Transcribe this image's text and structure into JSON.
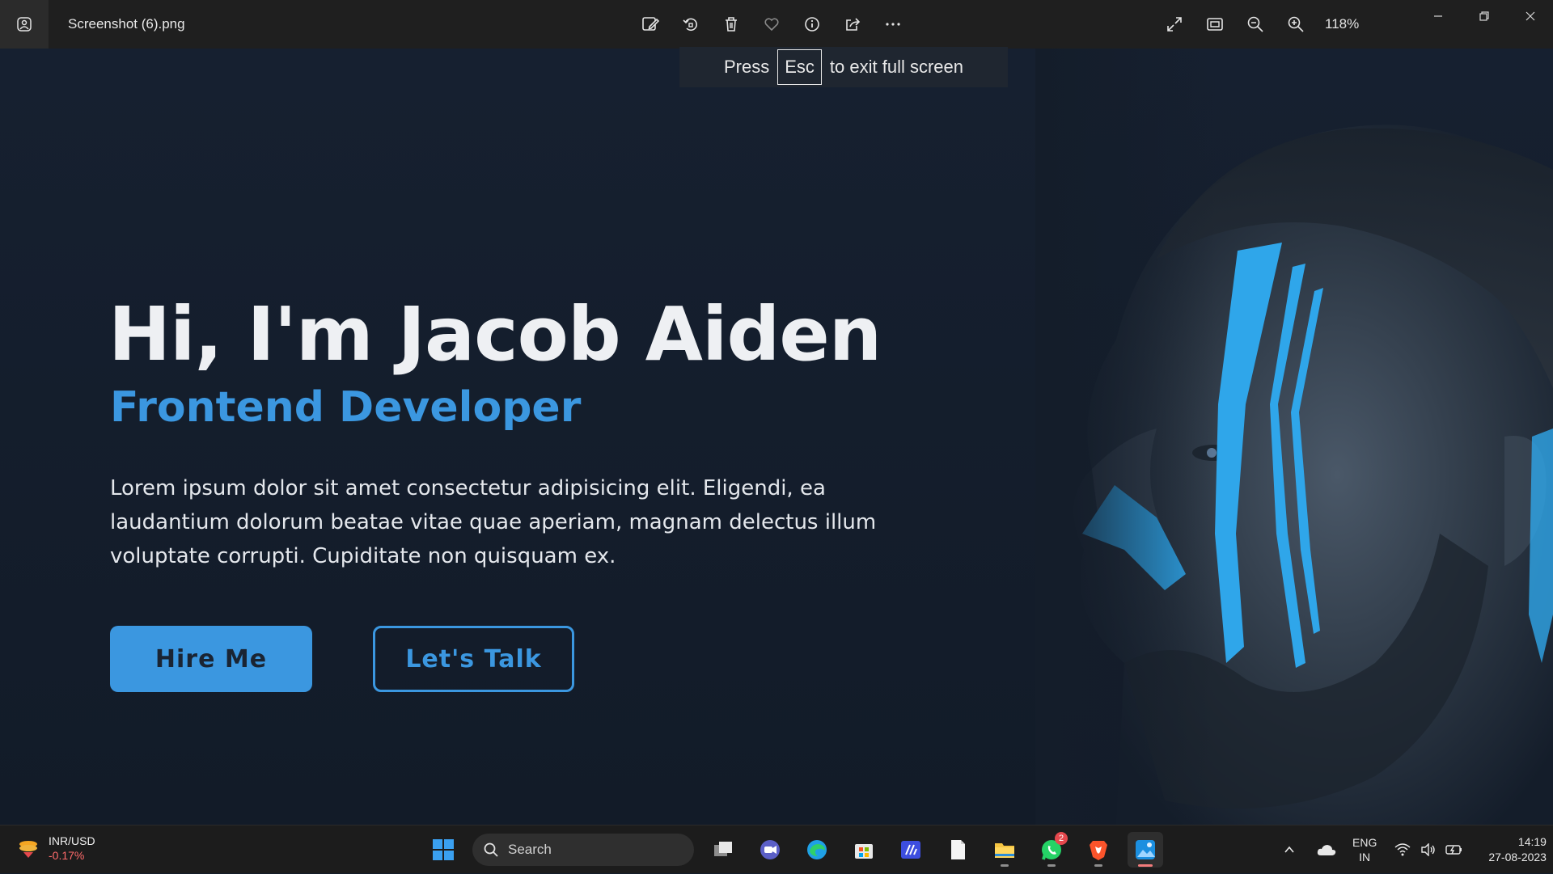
{
  "window": {
    "file_name": "Screenshot (6).png",
    "zoom": "118%"
  },
  "esc_notice": {
    "before": "Press",
    "key": "Esc",
    "after": "to exit full screen"
  },
  "hero": {
    "title": "Hi, I'm Jacob Aiden",
    "subtitle": "Frontend Developer",
    "description": "Lorem ipsum dolor sit amet consectetur adipisicing elit. Eligendi, ea laudantium dolorum beatae vitae quae aperiam, magnam delectus illum voluptate corrupti. Cupiditate non quisquam ex.",
    "primary_button": "Hire Me",
    "secondary_button": "Let's Talk",
    "accent_color": "#3b97e0"
  },
  "taskbar": {
    "widget": {
      "title": "INR/USD",
      "change": "-0.17%"
    },
    "search_placeholder": "Search",
    "whatsapp_badge": "2",
    "lang_primary": "ENG",
    "lang_secondary": "IN",
    "time": "14:19",
    "date": "27-08-2023"
  },
  "icons": [
    "photos-app-icon",
    "edit-image-icon",
    "rotate-icon",
    "delete-icon",
    "favorite-icon",
    "info-icon",
    "share-icon",
    "more-icon",
    "fullscreen-icon",
    "fit-icon",
    "zoom-out-icon",
    "zoom-in-icon",
    "minimize-icon",
    "restore-icon",
    "close-icon"
  ]
}
